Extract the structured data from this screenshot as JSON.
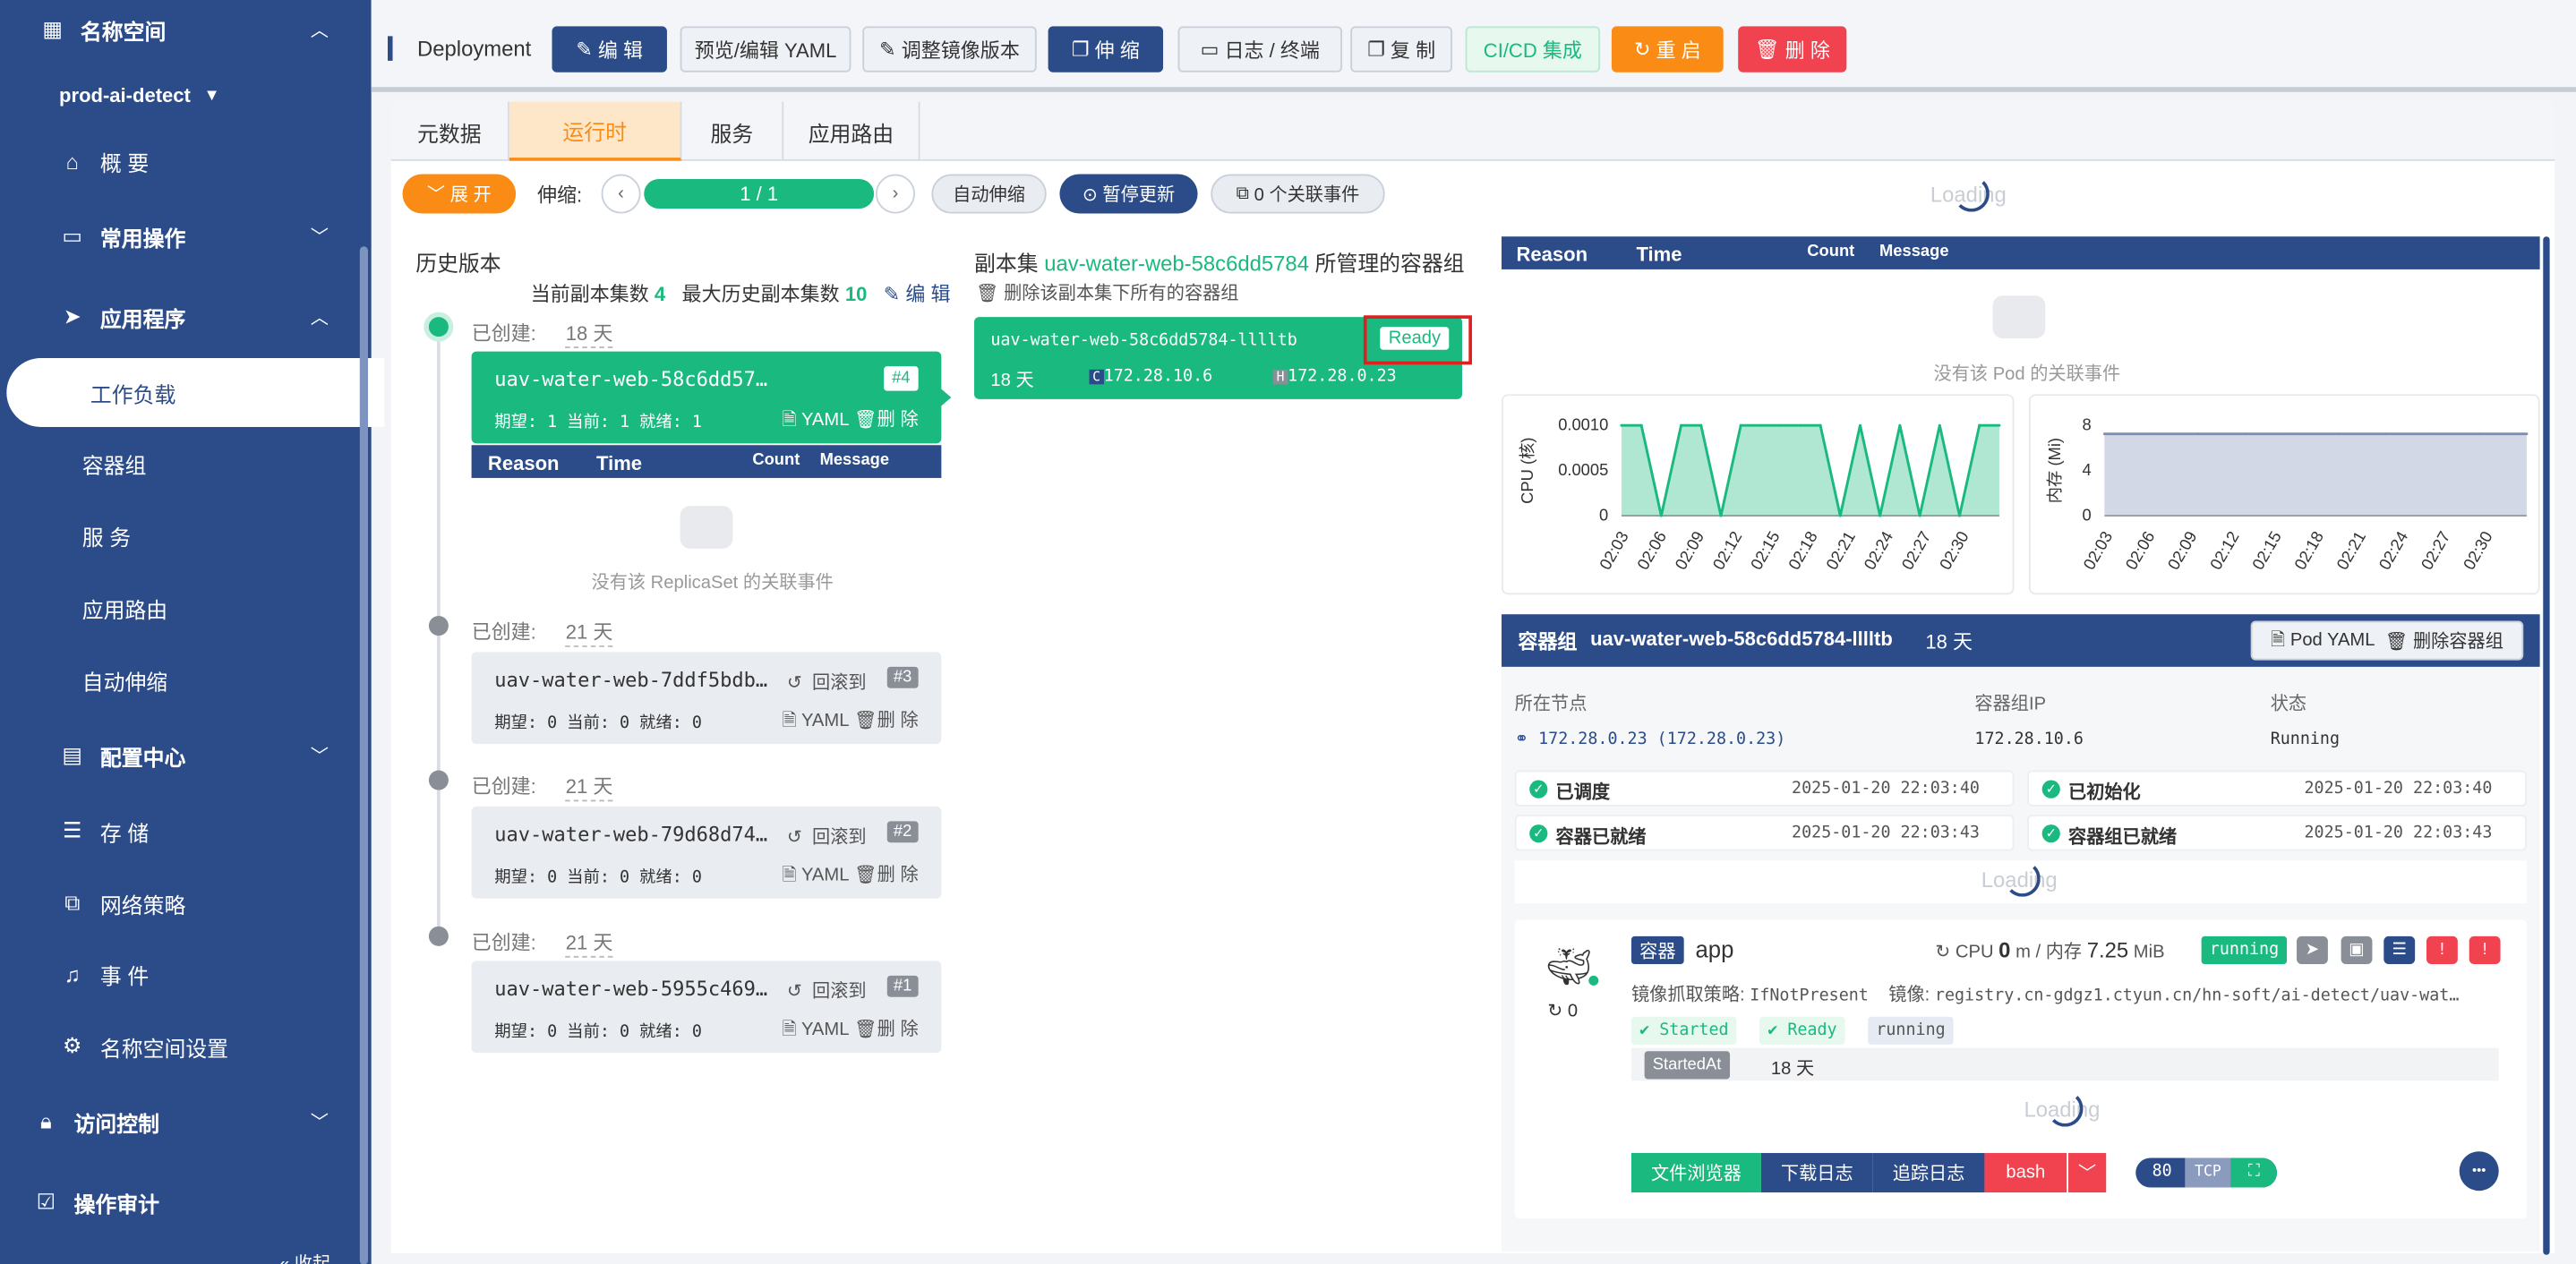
{
  "sidebar": {
    "namespace_label": "名称空间",
    "namespace_value": "prod-ai-detect",
    "overview": "概 要",
    "common_ops": "常用操作",
    "applications": "应用程序",
    "workloads": "工作负载",
    "pods": "容器组",
    "services": "服 务",
    "routes": "应用路由",
    "autoscale": "自动伸缩",
    "config_center": "配置中心",
    "storage": "存 储",
    "network_policy": "网络策略",
    "events": "事 件",
    "ns_settings": "名称空间设置",
    "access_control": "访问控制",
    "audit": "操作审计",
    "collapse": "« 收起"
  },
  "toolbar": {
    "title": "Deployment",
    "edit": "编 辑",
    "preview_yaml": "预览/编辑 YAML",
    "adjust_image": "调整镜像版本",
    "scale": "伸 缩",
    "logs_terminal": "日志 / 终端",
    "copy": "复 制",
    "cicd": "CI/CD 集成",
    "restart": "重 启",
    "delete": "删 除"
  },
  "tabs": [
    "元数据",
    "运行时",
    "服务",
    "应用路由"
  ],
  "controls": {
    "expand": "展 开",
    "scale_label": "伸缩:",
    "scale_value": "1 / 1",
    "autoscale": "自动伸缩",
    "pause": "暂停更新",
    "events": "0 个关联事件",
    "loading": "Loading"
  },
  "history": {
    "title": "历史版本",
    "current_label": "当前副本集数",
    "current_value": "4",
    "max_label": "最大历史副本集数",
    "max_value": "10",
    "edit": "编 辑",
    "created_label": "已创建:",
    "rollback": "回滚到",
    "yaml": "YAML",
    "delete": "删 除",
    "items": [
      {
        "created": "18 天",
        "name": "uav-water-web-58c6dd57…",
        "badge": "#4",
        "meta": "期望: 1 当前: 1 就绪: 1"
      },
      {
        "created": "21 天",
        "name": "uav-water-web-7ddf5bdb…",
        "badge": "#3",
        "meta": "期望: 0 当前: 0 就绪: 0"
      },
      {
        "created": "21 天",
        "name": "uav-water-web-79d68d74…",
        "badge": "#2",
        "meta": "期望: 0 当前: 0 就绪: 0"
      },
      {
        "created": "21 天",
        "name": "uav-water-web-5955c469…",
        "badge": "#1",
        "meta": "期望: 0 当前: 0 就绪: 0"
      }
    ],
    "events_head": {
      "reason": "Reason",
      "time": "Time",
      "count": "Count",
      "message": "Message"
    },
    "empty": "没有该 ReplicaSet 的关联事件"
  },
  "replicaset": {
    "prefix": "副本集",
    "name": "uav-water-web-58c6dd5784",
    "suffix": "所管理的容器组",
    "delete_all": "删除该副本集下所有的容器组",
    "pod": {
      "name": "uav-water-web-58c6dd5784-lllltb",
      "status": "Ready",
      "age": "18 天",
      "pod_ip": "172.28.10.6",
      "host_ip": "172.28.0.23",
      "c_tag": "C",
      "h_tag": "H"
    }
  },
  "pod_events": {
    "head": {
      "reason": "Reason",
      "time": "Time",
      "count": "Count",
      "message": "Message"
    },
    "empty": "没有该 Pod 的关联事件"
  },
  "chart_data": [
    {
      "type": "area",
      "ylabel": "CPU (核)",
      "ylim": [
        0,
        0.001
      ],
      "yticks": [
        "0.0010",
        "0.0005",
        "0"
      ],
      "categories": [
        "02:03",
        "02:06",
        "02:09",
        "02:12",
        "02:15",
        "02:18",
        "02:21",
        "02:24",
        "02:27",
        "02:30"
      ],
      "values": [
        0.001,
        0.001,
        0,
        0.001,
        0.001,
        0,
        0.001,
        0.001,
        0.001,
        0.001,
        0.001,
        0,
        0.001,
        0,
        0.001,
        0,
        0.001,
        0,
        0.001,
        0.001
      ],
      "color": "#19b97f"
    },
    {
      "type": "area",
      "ylabel": "内存 (Mi)",
      "ylim": [
        0,
        8
      ],
      "yticks": [
        "8",
        "4",
        "0"
      ],
      "categories": [
        "02:03",
        "02:06",
        "02:09",
        "02:12",
        "02:15",
        "02:18",
        "02:21",
        "02:24",
        "02:27",
        "02:30"
      ],
      "values": [
        7.25,
        7.25,
        7.25,
        7.25,
        7.25,
        7.25,
        7.25,
        7.25,
        7.25,
        7.25
      ],
      "color": "#7d8fb8"
    }
  ],
  "pod": {
    "label": "容器组",
    "name": "uav-water-web-58c6dd5784-lllltb",
    "age": "18 天",
    "pod_yaml": "Pod YAML",
    "delete_pod": "删除容器组",
    "node_label": "所在节点",
    "ip_label": "容器组IP",
    "status_label": "状态",
    "node": "172.28.0.23 (172.28.0.23)",
    "ip": "172.28.10.6",
    "status": "Running",
    "conditions": [
      {
        "name": "已调度",
        "time": "2025-01-20 22:03:40"
      },
      {
        "name": "已初始化",
        "time": "2025-01-20 22:03:40"
      },
      {
        "name": "容器已就绪",
        "time": "2025-01-20 22:03:43"
      },
      {
        "name": "容器组已就绪",
        "time": "2025-01-20 22:03:43"
      }
    ]
  },
  "container": {
    "tag": "容器",
    "name": "app",
    "restarts": "0",
    "cpu_label": "CPU",
    "cpu_value": "0",
    "cpu_unit": "m / 内存",
    "mem_value": "7.25",
    "mem_unit": "MiB",
    "state": "running",
    "pull_policy_label": "镜像抓取策略:",
    "pull_policy": "IfNotPresent",
    "image_label": "镜像:",
    "image": "registry.cn-gdgz1.ctyun.cn/hn-soft/ai-detect/uav-wat…",
    "tags": [
      "Started",
      "Ready",
      "running"
    ],
    "started_at_label": "StartedAt",
    "started_at": "18 天",
    "file_browser": "文件浏览器",
    "download_log": "下载日志",
    "follow_log": "追踪日志",
    "shell": "bash",
    "port": "80",
    "protocol": "TCP",
    "more": "•••"
  }
}
